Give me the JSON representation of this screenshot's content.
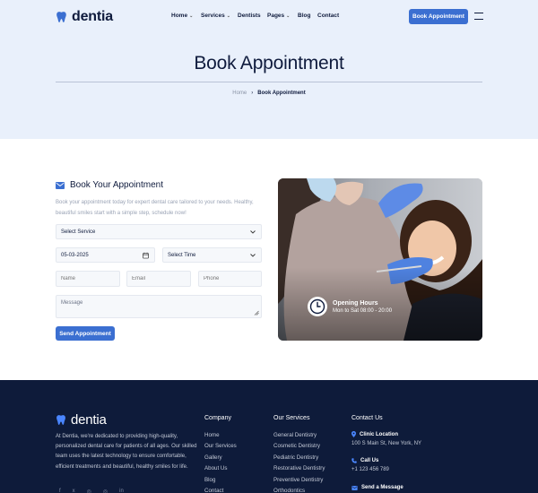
{
  "brand": {
    "name": "dentia",
    "accent": "#3b6fd1",
    "dark": "#0e1b3a"
  },
  "nav": {
    "items": [
      {
        "label": "Home",
        "dropdown": true
      },
      {
        "label": "Services",
        "dropdown": true
      },
      {
        "label": "Dentists",
        "dropdown": false
      },
      {
        "label": "Pages",
        "dropdown": true
      },
      {
        "label": "Blog",
        "dropdown": false
      },
      {
        "label": "Contact",
        "dropdown": false
      }
    ],
    "cta_label": "Book Appointment"
  },
  "hero": {
    "title": "Book Appointment",
    "breadcrumb": {
      "home": "Home",
      "separator": "›",
      "current": "Book Appointment"
    }
  },
  "form": {
    "title": "Book Your Appointment",
    "description": "Book your appointment today for expert dental care tailored to your needs. Healthy, beautiful smiles start with a simple step, schedule now!",
    "service_select": "Select Service",
    "date_value": "05-03-2025",
    "time_select": "Select Time",
    "name_placeholder": "Name",
    "email_placeholder": "Email",
    "phone_placeholder": "Phone",
    "message_placeholder": "Message",
    "submit_label": "Send Appointment"
  },
  "hours": {
    "title": "Opening Hours",
    "subtitle": "Mon to Sat 08:00 - 20:00"
  },
  "footer": {
    "about": "At Dentia, we're dedicated to providing high-quality, personalized dental care for patients of all ages. Our skilled team uses the latest technology to ensure comfortable, efficient treatments and beautiful, healthy smiles for life.",
    "company": {
      "title": "Company",
      "links": [
        "Home",
        "Our Services",
        "Gallery",
        "About Us",
        "Blog",
        "Contact"
      ]
    },
    "services": {
      "title": "Our Services",
      "links": [
        "General Dentistry",
        "Cosmetic Dentistry",
        "Pediatric Dentistry",
        "Restorative Dentistry",
        "Preventive Dentistry",
        "Orthodontics"
      ]
    },
    "contact": {
      "title": "Contact Us",
      "location_label": "Clinic Location",
      "location_value": "100 S Main St, New York, NY",
      "call_label": "Call Us",
      "call_value": "+1 123 456 789",
      "message_label": "Send a Message"
    },
    "socials": [
      "f",
      "x",
      "◎",
      "◎",
      "in"
    ]
  }
}
